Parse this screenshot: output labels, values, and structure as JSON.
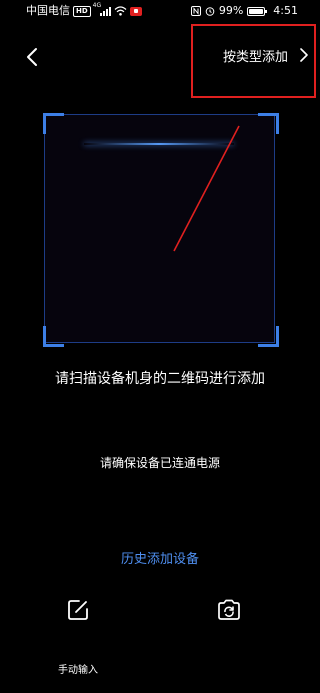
{
  "status_bar": {
    "carrier": "中国电信",
    "hd_badge": "HD",
    "network": "4G",
    "battery_percent": "99%",
    "time": "4:51",
    "icons": [
      "hd-icon",
      "signal-icon",
      "wifi-icon",
      "recording-icon",
      "nfc-icon",
      "alarm-icon",
      "battery-icon"
    ],
    "battery_level": 0.99
  },
  "header": {
    "back_icon": "chevron-left-icon",
    "type_add_label": "按类型添加",
    "type_add_icon": "chevron-right-icon"
  },
  "scanner": {
    "hint": "请扫描设备机身的二维码进行添加",
    "accent_color": "#3d7fe6"
  },
  "power_hint": "请确保设备已连通电源",
  "history_link": "历史添加设备",
  "actions": {
    "manual_input_label": "手动输入",
    "manual_input_icon": "edit-icon",
    "flip_camera_icon": "camera-flip-icon"
  },
  "colors": {
    "background": "#000000",
    "link": "#4f8ff0",
    "annotation_red": "#e0201f"
  }
}
